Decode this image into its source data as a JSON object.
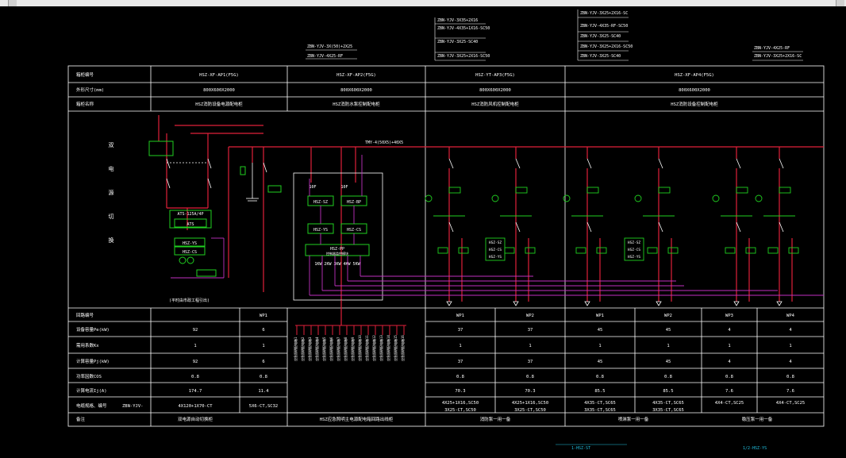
{
  "colors": {
    "bg": "#000000",
    "line": "#ffffff",
    "red": "#e0203a",
    "green": "#20d020",
    "yellow": "#e8e800",
    "magenta": "#c030c0",
    "cyan": "#20c0e0"
  },
  "header": {
    "rows": [
      "箱柜编号",
      "外形尺寸(mm)",
      "箱柜名称"
    ],
    "cols": [
      {
        "code": "HSZ-XF-AP1(F5G)",
        "size": "800X600X2000",
        "name": "HSZ消防设备电源配电柜"
      },
      {
        "code": "HSZ-XF-AP2(F5G)",
        "size": "800X600X2000",
        "name": "HSZ消防水泵控制配电柜"
      },
      {
        "code": "HSZ-YT-AP3(F5G)",
        "size": "800X600X2000",
        "name": "HSZ消防风机控制配电柜"
      },
      {
        "code": "HSZ-XF-AP4(F5G)",
        "size": "800X600X2000",
        "name": "HSZ消防设备控制配电柜"
      }
    ]
  },
  "top_notes": {
    "n1": [
      "ZBN-YJV-3X(50)+2X25",
      "ZBN-YJV-4X25-RF"
    ],
    "n2": [
      "ZBN-YJV-3X35+2X16",
      "ZBN-YJV-4X35+1X16-SC50",
      "ZBN-YJV-3X25-SC40",
      "ZBN-YJV-3X25+2X16-SC50"
    ],
    "n3": [
      "ZBN-YJV-3X25+2X16-SC",
      "ZBN-YJV-4X35-RF-SC50",
      "ZBN-YJV-3X25-SC40",
      "ZBN-YJV-3X25+2X16-SC50",
      "ZBN-YJV-3X25-SC40"
    ],
    "n4": [
      "ZBN-YJV-4X25-RF",
      "ZBN-YJV-3X25+2X16-SC"
    ]
  },
  "busbar": "TMY-4(50X5)+40X5",
  "left_label": [
    "双",
    "电",
    "源",
    "切",
    "换"
  ],
  "ats": {
    "top": "ATS-125A/4P",
    "box": "ATS",
    "ys": "HSZ-YS",
    "cs": "HSZ-CS"
  },
  "control": {
    "xf": "10F",
    "pf": "10F",
    "sz": "HSZ-SZ",
    "bp": "HSZ-BP",
    "ys": "HSZ-YS",
    "cs": "HSZ-CS",
    "pp": "HSZ-PP",
    "pp_sub": "控制器监控模块",
    "outs": "1KW 2KW 3KW 4KW 5KW"
  },
  "ctrl_modules": [
    "HSZ-SZ",
    "HSZ-CS",
    "HSZ-YS"
  ],
  "bottom_labels": {
    "bl1": "(平时由市政工程引出)",
    "cyan1": "1-HSZ-ST",
    "cyan2": "1/2-HSZ-YS"
  },
  "table": {
    "rows": [
      "回路编号",
      "设备容量Pe(kW)",
      "需用系数Kx",
      "计算容量Pj(kW)",
      "功率因数COS",
      "计算电流Ij(A)",
      "电缆规格、编号",
      "备注"
    ],
    "ap1": {
      "hdr": [
        "",
        "WP1"
      ],
      "pe": [
        "92",
        "6"
      ],
      "kx": [
        "1",
        "1"
      ],
      "pj": [
        "92",
        "6"
      ],
      "cos": [
        "0.8",
        "0.8"
      ],
      "ij": [
        "174.7",
        "11.4"
      ],
      "cable": [
        "4X120+1X70-CT",
        "5X6-CT,SC32"
      ],
      "cable_pre": "ZBN-YJV-",
      "note": "双电源自动切换柜"
    },
    "ap2_note": "HSZ应急照明主电源配电箱回路出线柜",
    "ap2_vtext": [
      "应急照明配电箱1",
      "应急照明配电箱2",
      "应急照明配电箱3",
      "应急照明配电箱4",
      "应急照明配电箱5",
      "应急照明配电箱6",
      "应急照明配电箱7",
      "应急照明配电箱8",
      "应急照明配电箱9",
      "应急照明配电箱10",
      "应急照明配电箱11",
      "应急照明配电箱12",
      "应急照明配电箱13",
      "应急照明配电箱14",
      "应急照明配电箱15",
      "应急照明配电箱16"
    ],
    "ap3": {
      "hdr": [
        "WP1",
        "WP2"
      ],
      "pe": [
        "37",
        "37"
      ],
      "kx": [
        "1",
        "1"
      ],
      "pj": [
        "37",
        "37"
      ],
      "cos": [
        "0.8",
        "0.8"
      ],
      "ij": [
        "70.3",
        "70.3"
      ],
      "cable": [
        [
          "4X25+1X16,SC50",
          "3X25-CT,SC50"
        ],
        [
          "4X25+1X16,SC50",
          "3X25-CT,SC50"
        ]
      ],
      "note": "消防泵一用一备"
    },
    "ap4": {
      "hdr": [
        "WP1",
        "WP2",
        "WP3",
        "WP4"
      ],
      "pe": [
        "45",
        "45",
        "4",
        "4"
      ],
      "kx": [
        "1",
        "1",
        "1",
        "1"
      ],
      "pj": [
        "45",
        "45",
        "4",
        "4"
      ],
      "cos": [
        "0.8",
        "0.8",
        "0.8",
        "0.8"
      ],
      "ij": [
        "85.5",
        "85.5",
        "7.6",
        "7.6"
      ],
      "cable": [
        [
          "4X35-CT,SC65",
          "3X35-CT,SC65"
        ],
        [
          "4X35-CT,SC65",
          "3X35-CT,SC65"
        ],
        [
          "4X4-CT,SC25",
          ""
        ],
        [
          "4X4-CT,SC25",
          ""
        ]
      ],
      "notes": [
        "喷淋泵一用一备",
        "稳压泵一用一备"
      ]
    }
  }
}
